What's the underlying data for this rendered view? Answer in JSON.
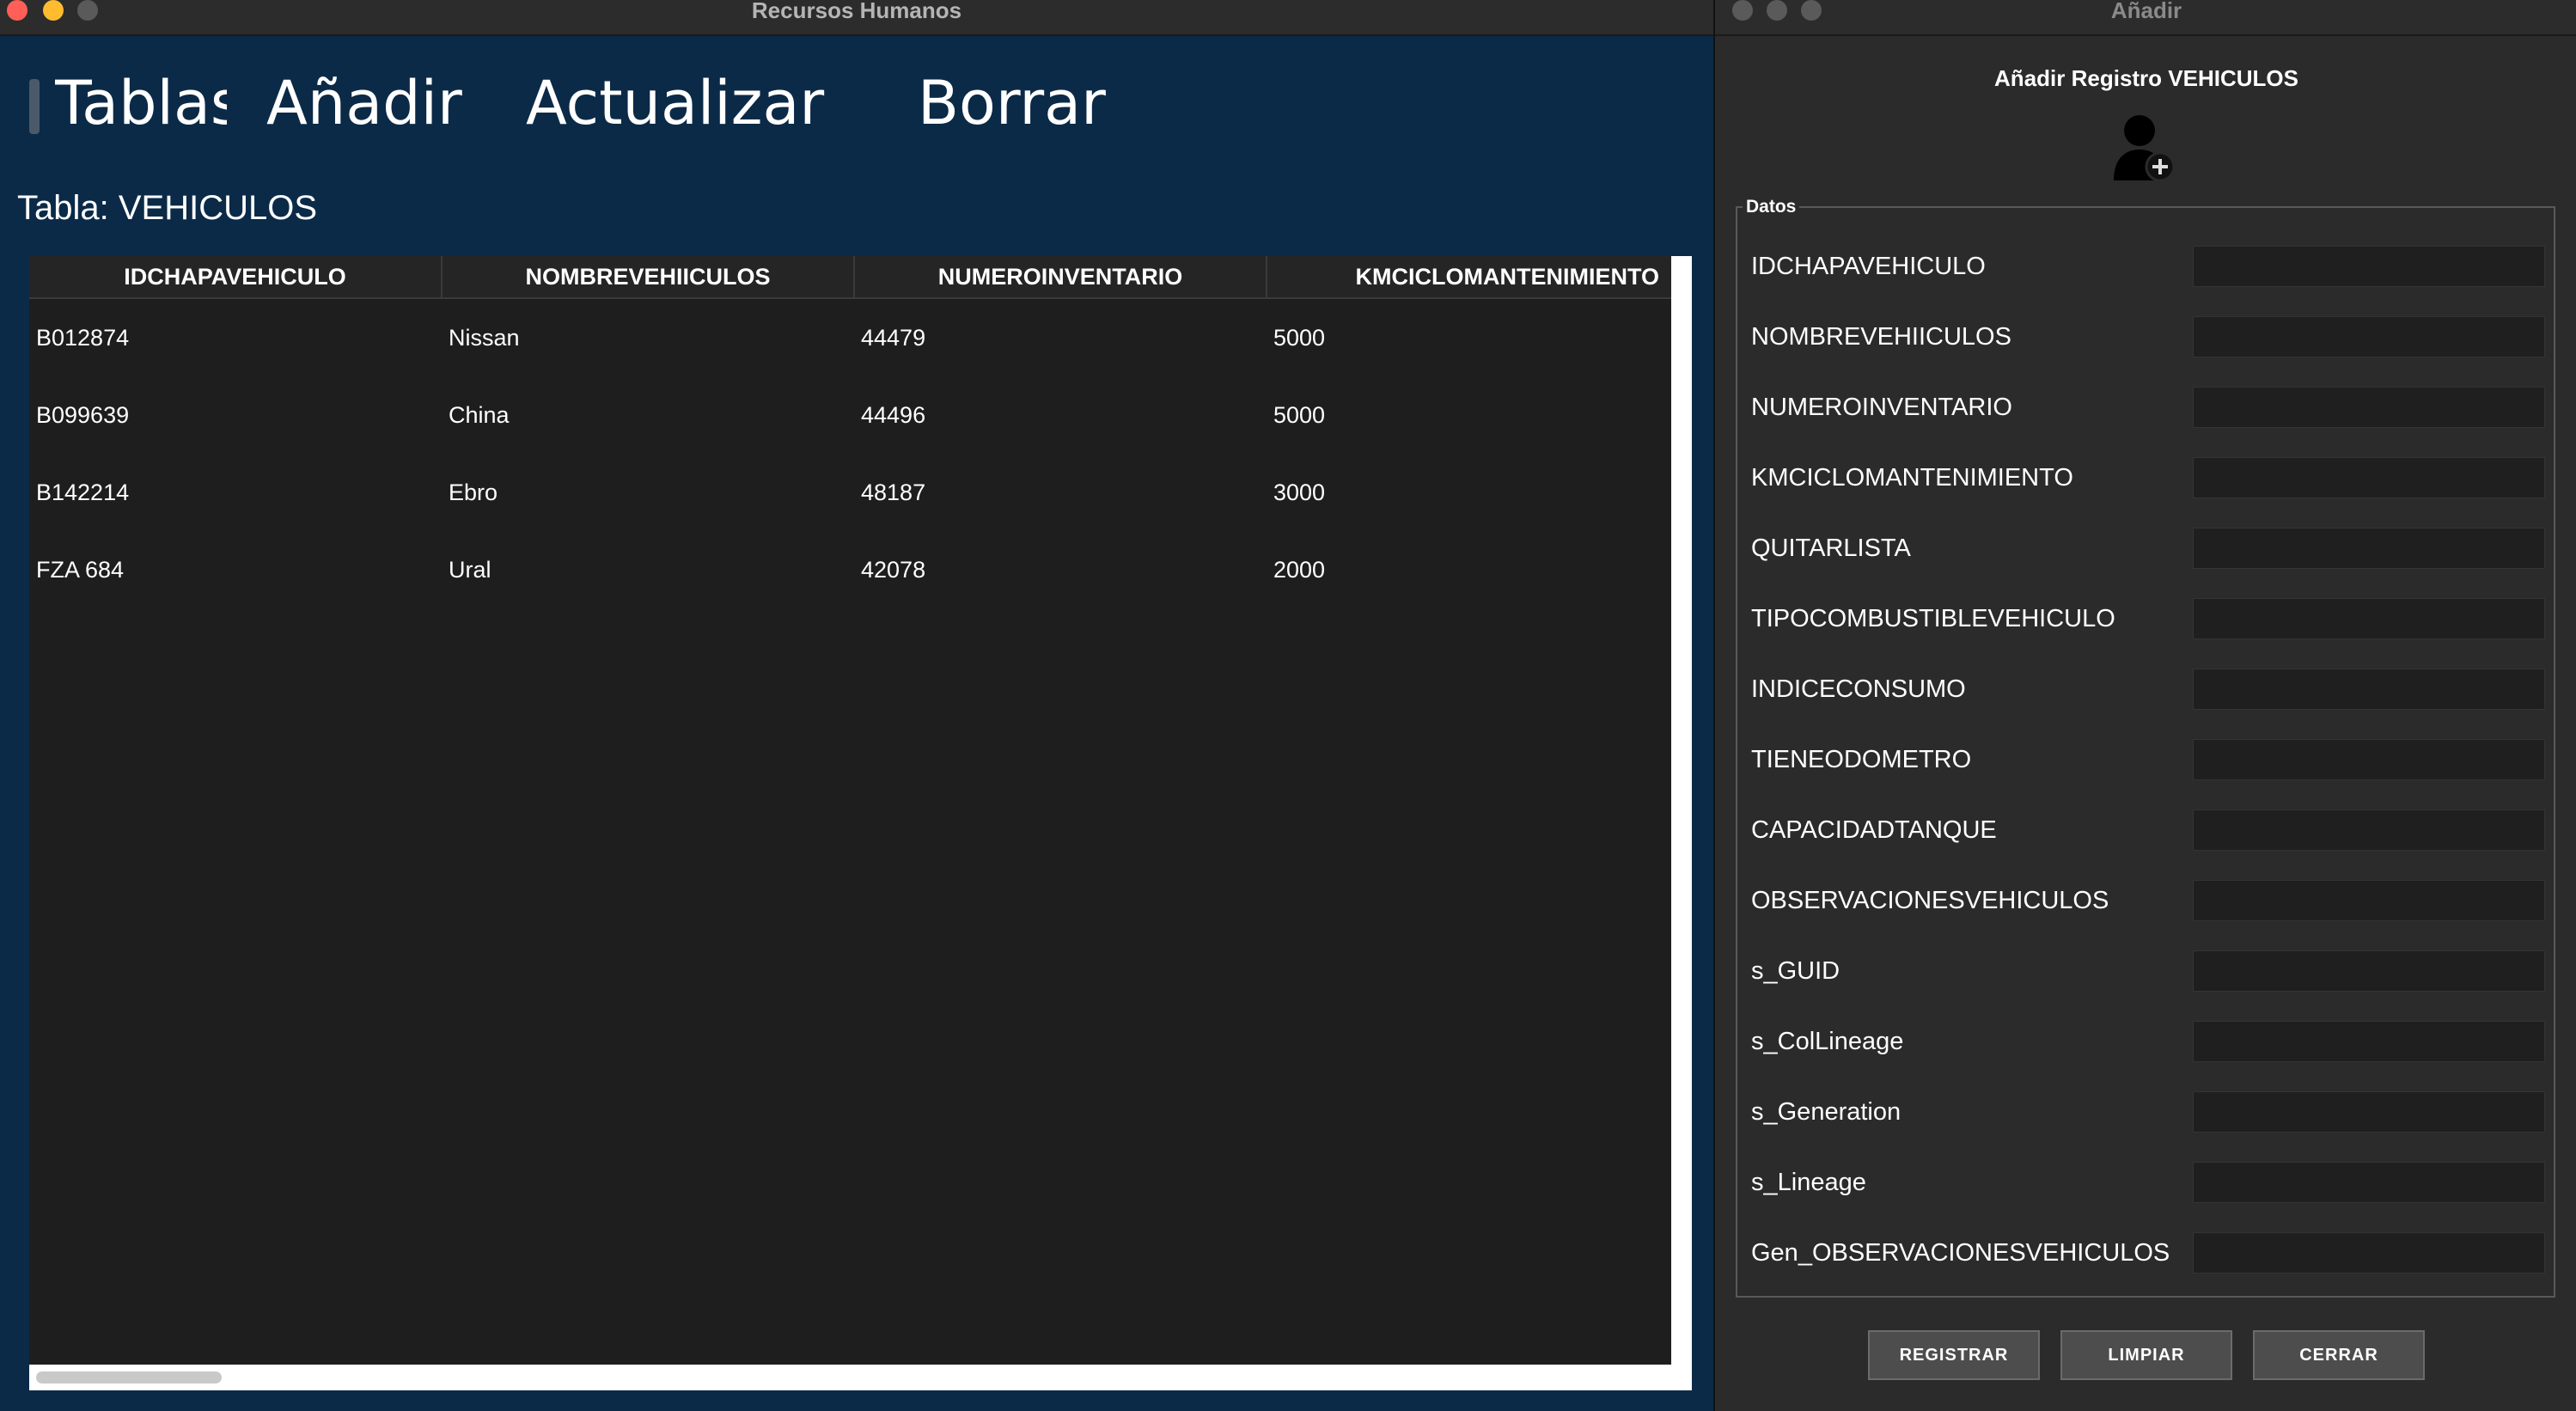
{
  "main_window": {
    "title": "Recursos Humanos",
    "menu": {
      "tables": "Tablas",
      "add": "Añadir",
      "update": "Actualizar",
      "delete": "Borrar"
    },
    "table_caption": "Tabla: VEHICULOS",
    "table": {
      "columns": [
        "IDCHAPAVEHICULO",
        "NOMBREVEHIICULOS",
        "NUMEROINVENTARIO",
        "KMCICLOMANTENIMIENTO"
      ],
      "rows": [
        [
          "B012874",
          "Nissan",
          "44479",
          "5000"
        ],
        [
          "B099639",
          "China",
          "44496",
          "5000"
        ],
        [
          "B142214",
          "Ebro",
          "48187",
          "3000"
        ],
        [
          "FZA 684",
          "Ural",
          "42078",
          "2000"
        ]
      ]
    }
  },
  "dialog": {
    "title": "Añadir",
    "heading": "Añadir Registro VEHICULOS",
    "group_label": "Datos",
    "fields": [
      {
        "label": "IDCHAPAVEHICULO",
        "value": ""
      },
      {
        "label": "NOMBREVEHIICULOS",
        "value": ""
      },
      {
        "label": "NUMEROINVENTARIO",
        "value": ""
      },
      {
        "label": "KMCICLOMANTENIMIENTO",
        "value": ""
      },
      {
        "label": "QUITARLISTA",
        "value": ""
      },
      {
        "label": "TIPOCOMBUSTIBLEVEHICULO",
        "value": ""
      },
      {
        "label": "INDICECONSUMO",
        "value": ""
      },
      {
        "label": "TIENEODOMETRO",
        "value": ""
      },
      {
        "label": "CAPACIDADTANQUE",
        "value": ""
      },
      {
        "label": "OBSERVACIONESVEHICULOS",
        "value": ""
      },
      {
        "label": "s_GUID",
        "value": ""
      },
      {
        "label": "s_ColLineage",
        "value": ""
      },
      {
        "label": "s_Generation",
        "value": ""
      },
      {
        "label": "s_Lineage",
        "value": ""
      },
      {
        "label": "Gen_OBSERVACIONESVEHICULOS",
        "value": ""
      }
    ],
    "buttons": {
      "register": "REGISTRAR",
      "clear": "LIMPIAR",
      "close": "CERRAR"
    },
    "icon": "user-add-icon"
  },
  "colors": {
    "main_background": "#0b2a47",
    "table_background": "#1e1e1e",
    "dialog_background": "#2b2b2b",
    "input_background": "#1f1f1f",
    "close_light": "#ff5f57",
    "minimize_light": "#febc2e",
    "inactive_light": "#5a5a5a"
  }
}
